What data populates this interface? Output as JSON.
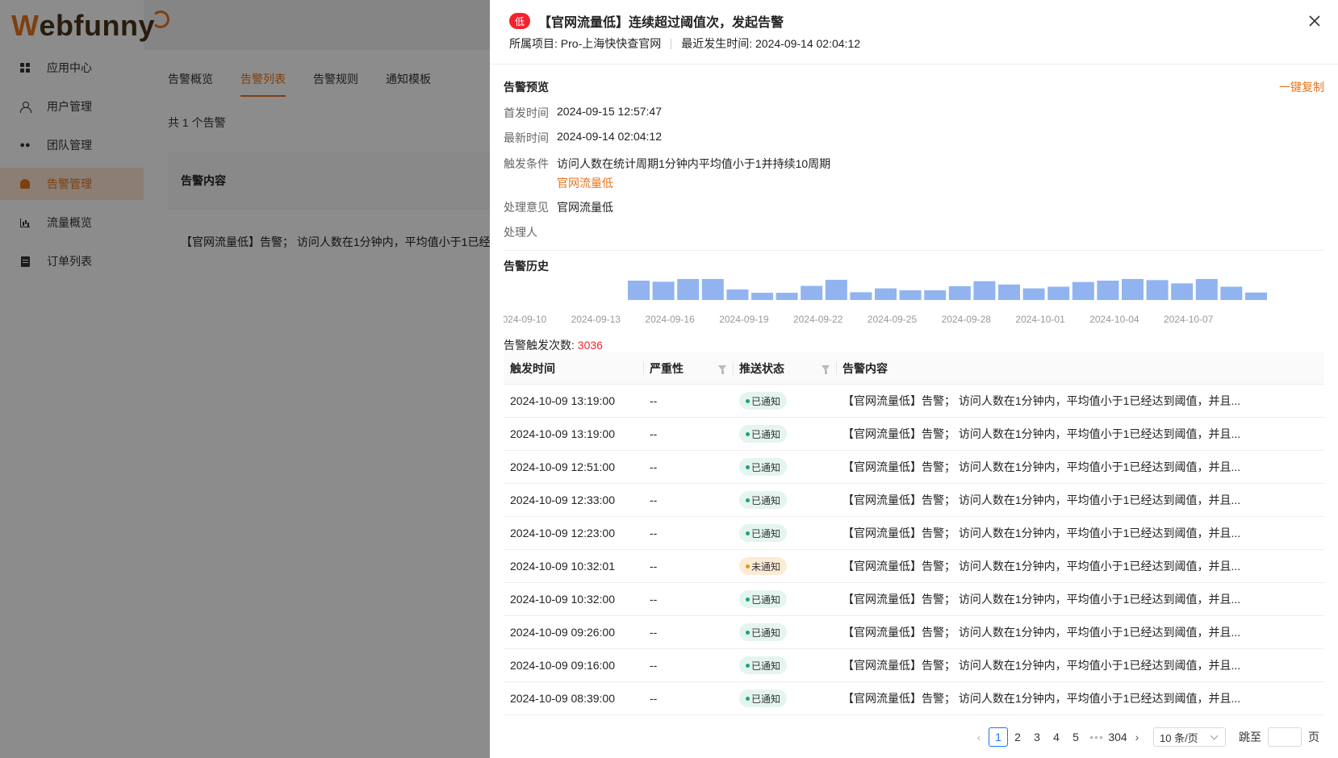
{
  "logo": {
    "first": "W",
    "rest": "ebfunny"
  },
  "nav": [
    {
      "label": "应用中心",
      "icon": "grid-icon"
    },
    {
      "label": "用户管理",
      "icon": "user-icon"
    },
    {
      "label": "团队管理",
      "icon": "team-icon"
    },
    {
      "label": "告警管理",
      "icon": "bell-icon",
      "active": true
    },
    {
      "label": "流量概览",
      "icon": "chart-icon"
    },
    {
      "label": "订单列表",
      "icon": "document-icon"
    }
  ],
  "main": {
    "tabs": [
      "告警概览",
      "告警列表",
      "告警规则",
      "通知模板"
    ],
    "active_tab": 1,
    "total": "共 1 个告警",
    "table_header": "告警内容",
    "table_row": "【官网流量低】告警； 访问人数在1分钟内，平均值小于1已经..."
  },
  "drawer": {
    "severity": "低",
    "title": "【官网流量低】连续超过阈值次，发起告警",
    "project": "所属项目: Pro-上海快快查官网",
    "last_time": "最近发生时间: 2024-09-14 02:04:12",
    "preview_title": "告警预览",
    "copy": "一键复制",
    "fields": {
      "first_label": "首发时间",
      "first_value": "2024-09-15 12:57:47",
      "latest_label": "最新时间",
      "latest_value": "2024-09-14 02:04:12",
      "cond_label": "触发条件",
      "cond_value": "访问人数在统计周期1分钟内平均值小于1并持续10周期",
      "cond_tag": "官网流量低",
      "opinion_label": "处理意见",
      "opinion_value": "官网流量低",
      "handler_label": "处理人"
    },
    "history_title": "告警历史",
    "count_label": "告警触发次数: ",
    "count_value": "3036",
    "table": {
      "headers": [
        "触发时间",
        "严重性",
        "推送状态",
        "告警内容"
      ],
      "rows": [
        {
          "time": "2024-10-09 13:19:00",
          "severity": "--",
          "status": "已通知",
          "ok": true,
          "content": "【官网流量低】告警； 访问人数在1分钟内，平均值小于1已经达到阈值，并且..."
        },
        {
          "time": "2024-10-09 13:19:00",
          "severity": "--",
          "status": "已通知",
          "ok": true,
          "content": "【官网流量低】告警； 访问人数在1分钟内，平均值小于1已经达到阈值，并且..."
        },
        {
          "time": "2024-10-09 12:51:00",
          "severity": "--",
          "status": "已通知",
          "ok": true,
          "content": "【官网流量低】告警； 访问人数在1分钟内，平均值小于1已经达到阈值，并且..."
        },
        {
          "time": "2024-10-09 12:33:00",
          "severity": "--",
          "status": "已通知",
          "ok": true,
          "content": "【官网流量低】告警； 访问人数在1分钟内，平均值小于1已经达到阈值，并且..."
        },
        {
          "time": "2024-10-09 12:23:00",
          "severity": "--",
          "status": "已通知",
          "ok": true,
          "content": "【官网流量低】告警； 访问人数在1分钟内，平均值小于1已经达到阈值，并且..."
        },
        {
          "time": "2024-10-09 10:32:01",
          "severity": "--",
          "status": "未通知",
          "ok": false,
          "content": "【官网流量低】告警； 访问人数在1分钟内，平均值小于1已经达到阈值，并且..."
        },
        {
          "time": "2024-10-09 10:32:00",
          "severity": "--",
          "status": "已通知",
          "ok": true,
          "content": "【官网流量低】告警； 访问人数在1分钟内，平均值小于1已经达到阈值，并且..."
        },
        {
          "time": "2024-10-09 09:26:00",
          "severity": "--",
          "status": "已通知",
          "ok": true,
          "content": "【官网流量低】告警； 访问人数在1分钟内，平均值小于1已经达到阈值，并且..."
        },
        {
          "time": "2024-10-09 09:16:00",
          "severity": "--",
          "status": "已通知",
          "ok": true,
          "content": "【官网流量低】告警； 访问人数在1分钟内，平均值小于1已经达到阈值，并且..."
        },
        {
          "time": "2024-10-09 08:39:00",
          "severity": "--",
          "status": "已通知",
          "ok": true,
          "content": "【官网流量低】告警； 访问人数在1分钟内，平均值小于1已经达到阈值，并且..."
        }
      ]
    },
    "pagination": {
      "pages": [
        "1",
        "2",
        "3",
        "4",
        "5"
      ],
      "ellipsis": "•••",
      "last": "304",
      "current": "1",
      "page_size": "10 条/页",
      "jump_label": "跳至",
      "page_suffix": "页"
    }
  },
  "colors": {
    "accent": "#e8741b",
    "bar": "#91b4f0",
    "danger": "#f5222d"
  },
  "chart_data": {
    "type": "bar",
    "title": "",
    "x": [
      "2024-09-10",
      "2024-09-11",
      "2024-09-12",
      "2024-09-13",
      "2024-09-14",
      "2024-09-15",
      "2024-09-16",
      "2024-09-17",
      "2024-09-18",
      "2024-09-19",
      "2024-09-20",
      "2024-09-21",
      "2024-09-22",
      "2024-09-23",
      "2024-09-24",
      "2024-09-25",
      "2024-09-26",
      "2024-09-27",
      "2024-09-28",
      "2024-09-29",
      "2024-09-30",
      "2024-10-01",
      "2024-10-02",
      "2024-10-03",
      "2024-10-04",
      "2024-10-05",
      "2024-10-06",
      "2024-10-07",
      "2024-10-08",
      "2024-10-09"
    ],
    "values": [
      0,
      0,
      0,
      0,
      0,
      70,
      66,
      80,
      105,
      38,
      26,
      26,
      51,
      73,
      28,
      42,
      35,
      35,
      50,
      68,
      56,
      42,
      48,
      65,
      70,
      82,
      72,
      60,
      98,
      48,
      27
    ],
    "tick_labels": [
      "2024-09-10",
      "2024-09-13",
      "2024-09-16",
      "2024-09-19",
      "2024-09-22",
      "2024-09-25",
      "2024-09-28",
      "2024-10-01",
      "2024-10-04",
      "2024-10-07"
    ],
    "xlabel": "",
    "ylabel": "",
    "grid": false,
    "legend": "none"
  }
}
